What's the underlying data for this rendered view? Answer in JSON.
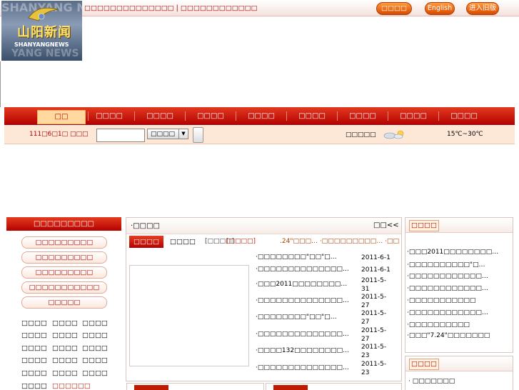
{
  "header": {
    "top_links": "□□□□□□□□□□□□□□ | □□□□□□□□□□□□",
    "buttons": [
      "□□□□",
      "English",
      "进入旧版"
    ],
    "logo": {
      "ghost_top": "SHANYANG N",
      "chinese": "山阳新闻",
      "english": "SHANYANGNEWS",
      "ghost_bottom": "YANG NEWS"
    }
  },
  "nav": {
    "items": [
      "□□",
      "□□□□",
      "□□□□",
      "□□□□",
      "□□□□",
      "□□□□",
      "□□□□",
      "□□□□",
      "□□□□"
    ],
    "active_index": 0
  },
  "infobar": {
    "date": "111□6□1□ □□□",
    "search_placeholder": "",
    "select_value": "□□□□",
    "weather_label": "□□□□□",
    "temperature": "15℃~30℃"
  },
  "left_panel": {
    "title": "□□□□□□□□□",
    "buttons": [
      "□□□□□□□□□",
      "□□□□□□□□□",
      "□□□□□□□□□",
      "□□□□□□□□□□□",
      "□□□□□"
    ],
    "grid": [
      [
        "□□□□",
        "□□□□",
        "□□□□"
      ],
      [
        "□□□□",
        "□□□□",
        "□□□□"
      ],
      [
        "□□□□",
        "□□□□",
        "□□□□"
      ],
      [
        "□□□□",
        "□□□□",
        "□□□□"
      ],
      [
        "□□□□",
        "□□□□",
        "□□□□"
      ],
      [
        "□□□□",
        "□□□□□□"
      ]
    ]
  },
  "center_panel": {
    "title": "·□□□□",
    "more": "□□<<",
    "tabs": [
      "□□□□",
      "□□□□"
    ],
    "tag_links": [
      "[□□□□]",
      "[□□□□]"
    ],
    "marquee": ".24\"□□□…  ·□□□□□□□□□…  ·□□□□□□0",
    "news": [
      {
        "title": "·□□□□□□□□\"□□\"□…",
        "date": "2011-6-1"
      },
      {
        "title": "·□□□□□□□□□□□□□□…",
        "date": "2011-6-1"
      },
      {
        "title": "·□□□2011□□□□□□□□…",
        "date": "2011-5-31"
      },
      {
        "title": "·□□□□□□□□□□□□□□…",
        "date": "2011-5-27"
      },
      {
        "title": "·□□□□□□□□\"□□\"□…",
        "date": "2011-5-27"
      },
      {
        "title": "·□□□□□□□□□□□□□□…",
        "date": "2011-5-27"
      },
      {
        "title": "·□□□□132□□□□□□□□…",
        "date": "2011-5-23"
      },
      {
        "title": "·□□□□□□□□□□□□□□…",
        "date": "2011-5-23"
      }
    ]
  },
  "right_panel": {
    "title": "□□□□",
    "items": [
      "·□□□2011□□□□□□□□…",
      "·□□□□□□□□□□\"□…",
      "·□□□□□□□□□□□□…",
      "·□□□□□□□□□□□□…",
      "·□□□□□□□□□□□",
      "·□□□□□□□□□□□□…",
      "·□□□□□□□□□□",
      "·□□□\"7.24\"□□□□□□□"
    ]
  },
  "right_panel2": {
    "title": "□□□□",
    "items": [
      "·  □□□□□□□"
    ]
  },
  "colors": {
    "brand_red": "#c01a00",
    "nav_red": "#d42a12",
    "accent_orange": "#ff8a2a"
  }
}
